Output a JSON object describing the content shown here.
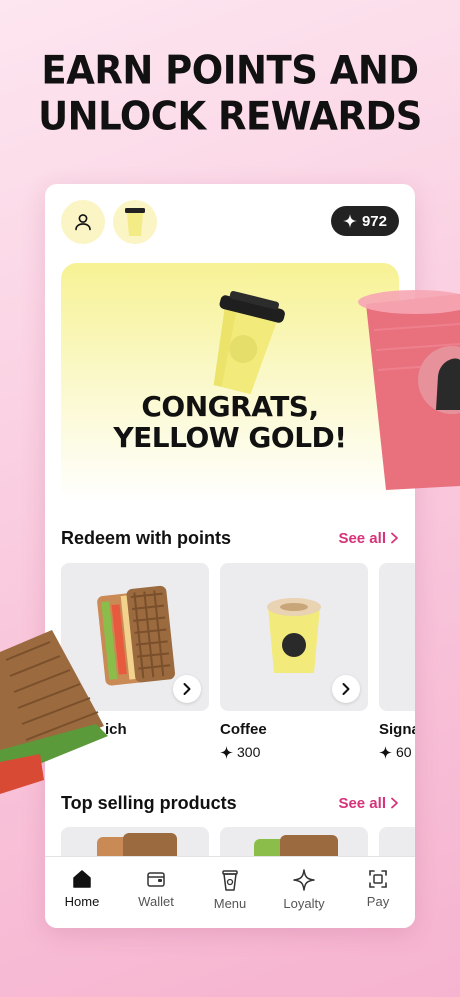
{
  "headline": {
    "line1": "EARN POINTS AND",
    "line2": "UNLOCK REWARDS"
  },
  "topbar": {
    "points": "972",
    "profile_icon": "person-icon",
    "cup_icon": "coffee-cup-icon"
  },
  "hero": {
    "line1": "CONGRATS,",
    "line2": "YELLOW GOLD!"
  },
  "redeem": {
    "title": "Redeem with points",
    "see_all": "See all",
    "items": [
      {
        "name": "ich",
        "points": ""
      },
      {
        "name": "Coffee",
        "points": "300"
      },
      {
        "name": "Signa",
        "points": "60"
      }
    ]
  },
  "top_selling": {
    "title": "Top selling products",
    "see_all": "See all"
  },
  "nav": {
    "items": [
      {
        "label": "Home",
        "icon": "home-icon",
        "active": true
      },
      {
        "label": "Wallet",
        "icon": "wallet-icon",
        "active": false
      },
      {
        "label": "Menu",
        "icon": "cup-icon",
        "active": false
      },
      {
        "label": "Loyalty",
        "icon": "sparkle-icon",
        "active": false
      },
      {
        "label": "Pay",
        "icon": "scan-icon",
        "active": false
      }
    ]
  },
  "colors": {
    "accent": "#d6337a",
    "hero_yellow": "#f7f294",
    "background_pink": "#f9c7dc"
  }
}
